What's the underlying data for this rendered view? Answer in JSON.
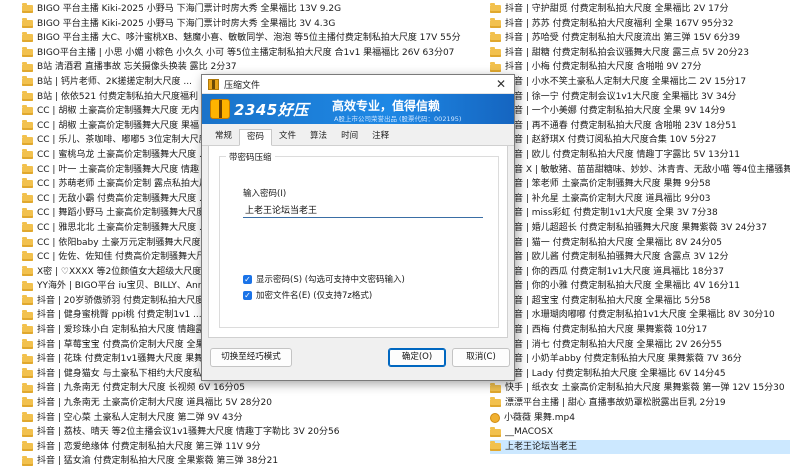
{
  "left_list": [
    "BIGO 平台主播 Kiki-2025 小野马 下海门票计时房大秀 全果福比 13V 9.2G",
    "BIGO 平台主播 Kiki-2025 小野马 下海门票计时房大秀 全果福比 3V 4.3G",
    "BIGO 平台主播 大C、哆汁蜜桃XB、魅魔小喜、敏敏同学、泡泡 等5位主播付费定制私拍大尺度 17V 55分",
    "BIGO平台主播 | 小思 小媚 小粽色 小久久 小可 等5位主播定制私拍大尺度 合1v1 果福福比 26V 63分07",
    "B站 清酒君 直播事故 忘关摄像头换装 露比 2分37",
    "B站 | 钙片老师、2K搓搓定制大尺度 ...",
    "B站 | 依依521 付费定制私拍大尺度福利 ...",
    "CC | 胡椒 土豪高价定制骚舞大尺度 无内 ...",
    "CC | 胡椒 土豪高价定制骚舞大尺度 果福 2V 6分",
    "CC | 乐儿、茶咖啡、嘟嘟5 3位定制大尺度 ...",
    "CC | 蜜桃乌龙 土豪高价定制骚舞大尺度 ...",
    "CC | 叶一 土豪高价定制骚舞大尺度 情趣 ...",
    "CC | 苏萌老师 土豪高价定制 露点私拍大尺度 ...",
    "CC | 无敌小霸 付费高价定制骚舞大尺度 ...",
    "CC | 舞蹈小野马 土豪高价定制骚舞大尺度 ...",
    "CC | 雅思北北 土豪高价定制骚舞大尺度 ...",
    "CC | 依阳baby 土豪万元定制骚舞大尺度 ...",
    "CC | 佐佐、佐知佳 付费高价定制骚舞大尺度 ...",
    "X密 | ♡XXXX 等2位颜值女大超级大尺度私拍 ...",
    "YY海外 | BIGO平台 iu宝贝、BILLY、Annie安 ...",
    "抖音 | 20岁骄傲骄羽 付费定制私拍大尺度 ...",
    "抖音 | 健身蜜桃臀 ppi桃 付费定制1v1 ...",
    "抖音 | 爱珍珠小白 定制私拍大尺度 情趣露比 4 ...",
    "抖音 | 草莓宝宝 付费高价定制大尺度 全果私拍 4V ...",
    "抖音 | 花珠 付费定制1v1骚舞大尺度 果舞 5V ...",
    "抖音 | 健身猫女 与土豪私下相约大尺度私拍流出 ...",
    "抖音 | 九条南无 付费定制大尺度 长视频 6V 16分05",
    "抖音 | 九条南无 土豪高价定制大尺度 道具福比 5V 28分20",
    "抖音 | 空心菜 土豪私人定制大尺度 第二弹 9V 43分",
    "抖音 | 荔枝、晴天 等2位主播会议1v1骚舞大尺度 情趣丁字勒比 3V 20分56",
    "抖音 | 恋爱绝缘体 付费定制私拍大尺度 第三弹 11V 9分",
    "抖音 | 猛女渝 付费定制私拍大尺度 全果紫薇 第三弹 38分21"
  ],
  "right_list": [
    "抖音 | 守护甜觅 付费定制私拍大尺度 全果福比 2V 17分",
    "抖音 | 苏苏 付费定制私拍大尺度福利 全果 167V 95分32",
    "抖音 | 苏哈受 付费定制私拍大尺度流出 第三弹 15V 6分39",
    "抖音 | 甜糖 付费定制私拍会议骚舞大尺度 露三点 5V 20分23",
    "抖音 | 小梅 付费定制私拍大尺度 含啪啪 9V 27分",
    "抖音 | 小水不笑土豪私人定制大尺度 全果福比二 2V 15分17",
    "抖音 | 徐一宁 付费定制会议1v1大尺度 全果福比 3V 34分",
    "抖音 | 一个小美娜 付费定制私拍大尺度 全果 9V 14分9",
    "抖音 | 再不通春 付费定制私拍大尺度 含啪啪 23V 18分51",
    "抖音 | 赵舒琪X 付费订阅私拍大尺度合集 10V 5分27",
    "抖音 | 欧儿 付费定制私拍大尺度 情趣丁字露比 5V 13分11",
    "抖音 X | 敏敏猪、苗苗甜糖味、妙妙、沐青青、无敌小喵 等4位主播骚舞大尺度剪辑",
    "抖音 | 笨老师 土豪高价定制骚舞大尺度 果舞 9分58",
    "抖音 | 补允星 土豪高价定制大尺度 道具福比 9分03",
    "抖音 | miss彩虹 付费定制1v1大尺度 全果 3V 7分38",
    "抖音 | 婚儿超超长 付费定制私拍骚舞大尺度 果舞紫薇 3V 24分37",
    "抖音 | 猫一 付费定制私拍大尺度 全果福比 8V 24分05",
    "抖音 | 欧儿酱 付费定制私拍骚舞大尺度 含露点 3V 12分",
    "抖音 | 你的西瓜 付费定制1v1大尺度 道具福比 18分37",
    "抖音 | 你的小雅 付费定制私拍大尺度 全果福比 4V 16分11",
    "抖音 | 超宝宝 付费定制私拍大尺度 全果福比 5分58",
    "抖音 | 水珊瑚肉嘟嘟 付费定制私拍1v1大尺度 全果福比 8V 30分10",
    "抖音 | 西梅 付费定制私拍大尺度 果舞紫薇 10分17",
    "抖音 | 消七 付费定制私拍大尺度 全果福比 2V 26分55",
    "抖音 | 小奶羊abby 付费定制私拍大尺度 果舞紫薇 7V 36分",
    "抖音 | Lady 付费定制私拍大尺度 全果福比 6V 14分45",
    "快手 | 纸衣女 土豪高价定制私拍大尺度 果舞紫薇 第一弹 12V 15分30",
    "漂漂平台主播 | 甜心 直播事故奶罩松脱露出巨乳 2分19",
    "小薇薇 果舞.mp4",
    "__MACOSX",
    "上老王论坛当老王"
  ],
  "dialog": {
    "title": "压缩文件",
    "close_glyph": "✕",
    "brand": "2345好压",
    "slogan": "高效专业，值得信赖",
    "slogan_sub": "A股上市公司荣誉出品 (股票代码：002195)",
    "tabs": [
      "常规",
      "密码",
      "文件",
      "算法",
      "时间",
      "注释"
    ],
    "active_tab": 1,
    "group_title": "带密码压缩",
    "password_label": "输入密码(I)",
    "password_value": "上老王论坛当老王",
    "show_password_label": "显示密码(S)  (勾选可支持中文密码输入)",
    "encrypt_filename_label": "加密文件名(E)  (仅支持7z格式)",
    "check_glyph": "✓",
    "switch_button": "切换至经巧模式",
    "ok_button": "确定(O)",
    "cancel_button": "取消(C)"
  },
  "colors": {
    "folder": "#f2c14e",
    "accent": "#1a73e8",
    "banner": "#1e88e5",
    "selected_row": "#cce8ff"
  }
}
